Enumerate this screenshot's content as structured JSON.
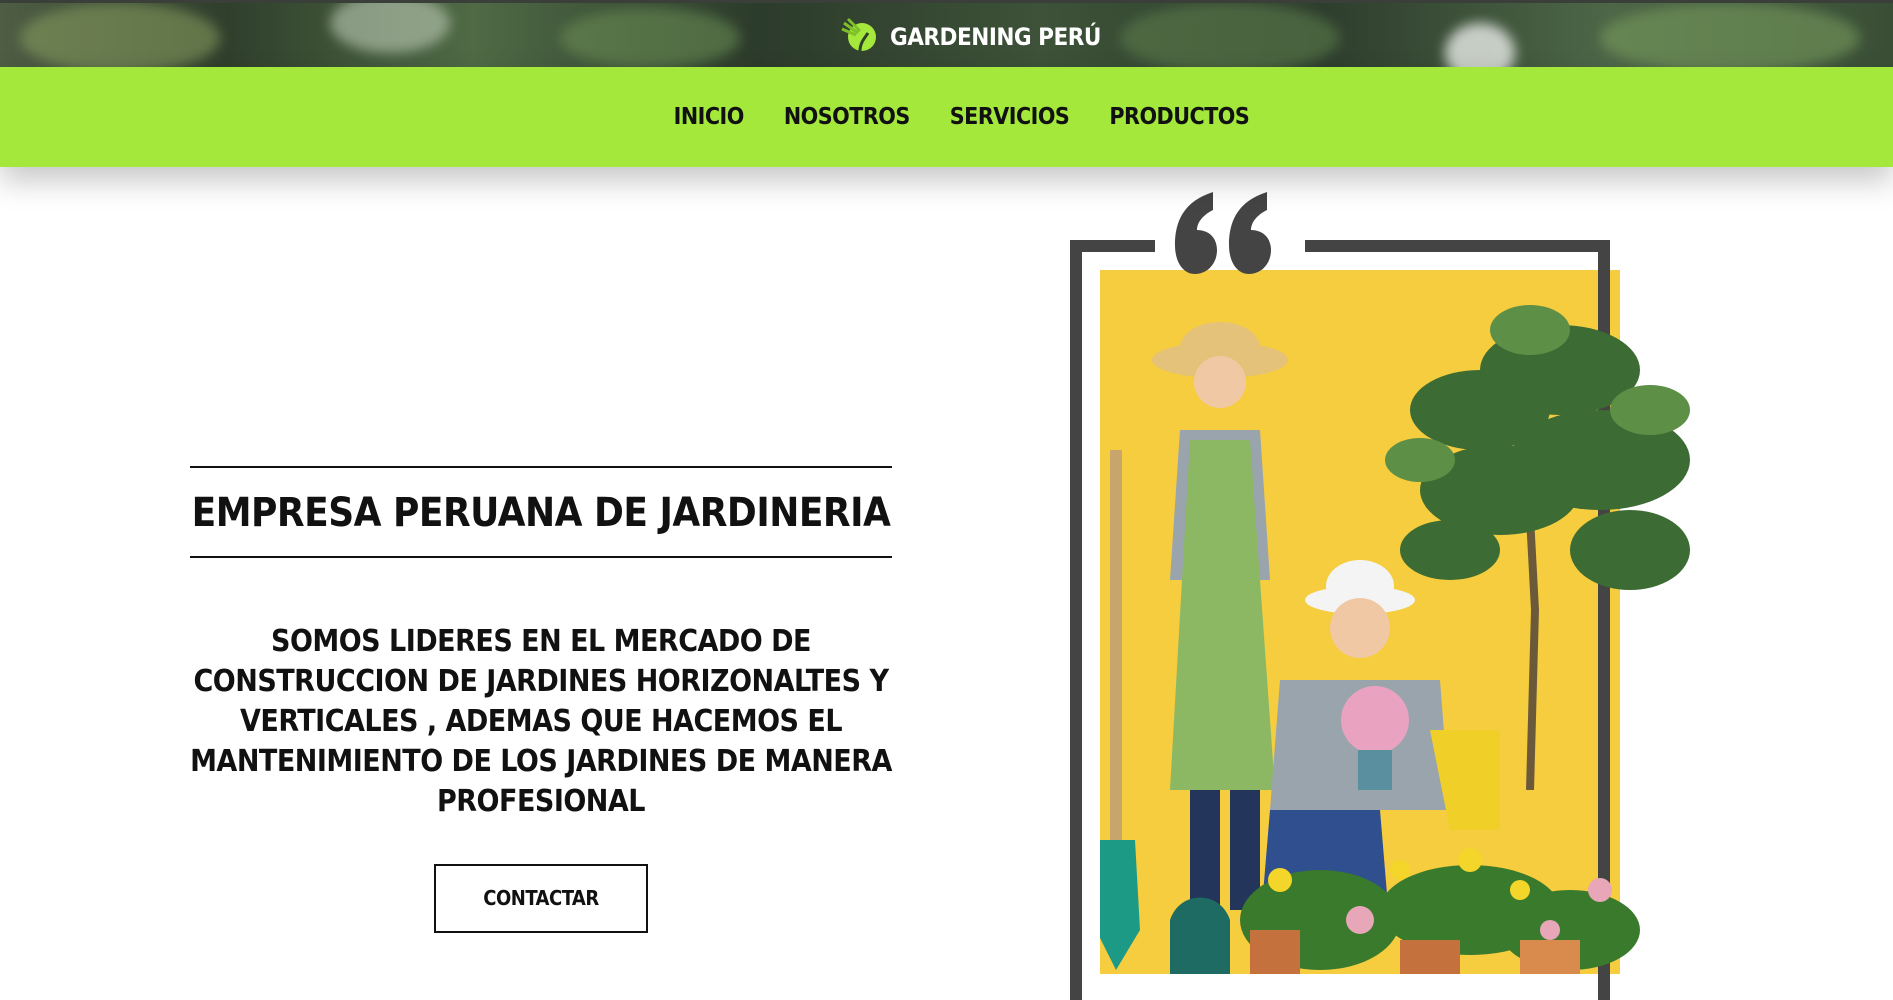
{
  "header": {
    "brand_title": "GARDENING PERÚ",
    "logo_icon": "tree-leaf-logo-icon"
  },
  "nav": {
    "items": [
      {
        "label": "INICIO"
      },
      {
        "label": "NOSOTROS"
      },
      {
        "label": "SERVICIOS"
      },
      {
        "label": "PRODUCTOS"
      }
    ]
  },
  "hero": {
    "title": "EMPRESA PERUANA DE JARDINERIA",
    "description": "SOMOS LIDERES EN EL MERCADO DE CONSTRUCCION DE JARDINES HORIZONALTES Y VERTICALES , ADEMAS QUE HACEMOS EL MANTENIMIENTO DE LOS JARDINES DE MANERA PROFESIONAL",
    "cta_label": "CONTACTAR",
    "illustration_icon": "quote-mark-icon"
  },
  "colors": {
    "nav_green": "#a3e83a",
    "art_yellow": "#f6cd3f",
    "frame_gray": "#444444"
  }
}
